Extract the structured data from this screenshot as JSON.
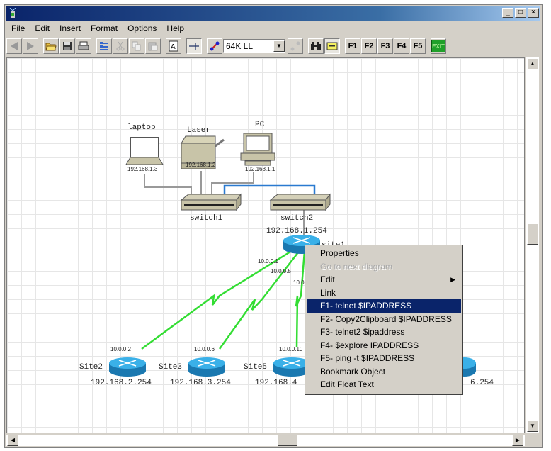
{
  "window": {
    "title": "",
    "controls": {
      "minimize": "_",
      "maximize": "□",
      "close": "×"
    }
  },
  "menubar": [
    "File",
    "Edit",
    "Insert",
    "Format",
    "Options",
    "Help"
  ],
  "toolbar": {
    "icons": [
      "back-icon",
      "forward-icon",
      "open-folder-icon",
      "save-icon",
      "print-icon",
      "properties-list-icon",
      "cut-icon",
      "copy-icon",
      "paste-icon",
      "text-icon",
      "link-mode-icon",
      "connection-icon"
    ],
    "link_type_combo": "64K LL",
    "fkeys": [
      "F1",
      "F2",
      "F3",
      "F4",
      "F5"
    ],
    "exit_label": "EXIT"
  },
  "diagram": {
    "devices": [
      {
        "name": "laptop",
        "ip": "192.168.1.3",
        "type": "laptop"
      },
      {
        "name": "Laser",
        "ip": "192.168.1.2",
        "type": "printer"
      },
      {
        "name": "PC",
        "ip": "192.168.1.1",
        "type": "pc"
      },
      {
        "name": "switch1",
        "type": "switch"
      },
      {
        "name": "switch2",
        "type": "switch"
      },
      {
        "name": "site1",
        "ip": "192.168.1.254",
        "type": "router"
      },
      {
        "name": "Site2",
        "ip": "192.168.2.254",
        "wan_ip": "10.0.0.2",
        "type": "router"
      },
      {
        "name": "Site3",
        "ip": "192.168.3.254",
        "wan_ip": "10.0.0.6",
        "type": "router"
      },
      {
        "name": "Site5",
        "ip": "192.168.4",
        "wan_ip": "10.0.0.10",
        "type": "router"
      },
      {
        "name": "",
        "ip": "6.254",
        "type": "router"
      }
    ],
    "link_labels": {
      "to_site2": "10.0.0.1",
      "to_site3": "10.0.0.5",
      "to_site5": "10.0."
    }
  },
  "context_menu": {
    "items": [
      {
        "label": "Properties",
        "state": "normal"
      },
      {
        "label": "Go to next diagram",
        "state": "disabled"
      },
      {
        "label": "Edit",
        "state": "submenu"
      },
      {
        "label": "Link",
        "state": "normal"
      },
      {
        "label": "F1- telnet $IPADDRESS",
        "state": "highlighted"
      },
      {
        "label": "F2- Copy2Clipboard $IPADDRESS",
        "state": "normal"
      },
      {
        "label": "F3- telnet2 $ipaddress",
        "state": "normal"
      },
      {
        "label": "F4- $explore IPADDRESS",
        "state": "normal"
      },
      {
        "label": "F5- ping -t $IPADDRESS",
        "state": "normal"
      },
      {
        "label": "Bookmark Object",
        "state": "normal"
      },
      {
        "label": "Edit Float Text",
        "state": "normal"
      }
    ]
  },
  "colors": {
    "titlebar": "#0a246a",
    "highlight": "#0a246a",
    "wan_link": "#33dd33",
    "lan_link_uplink": "#2a7ad0",
    "router": "#1e8fd0"
  }
}
